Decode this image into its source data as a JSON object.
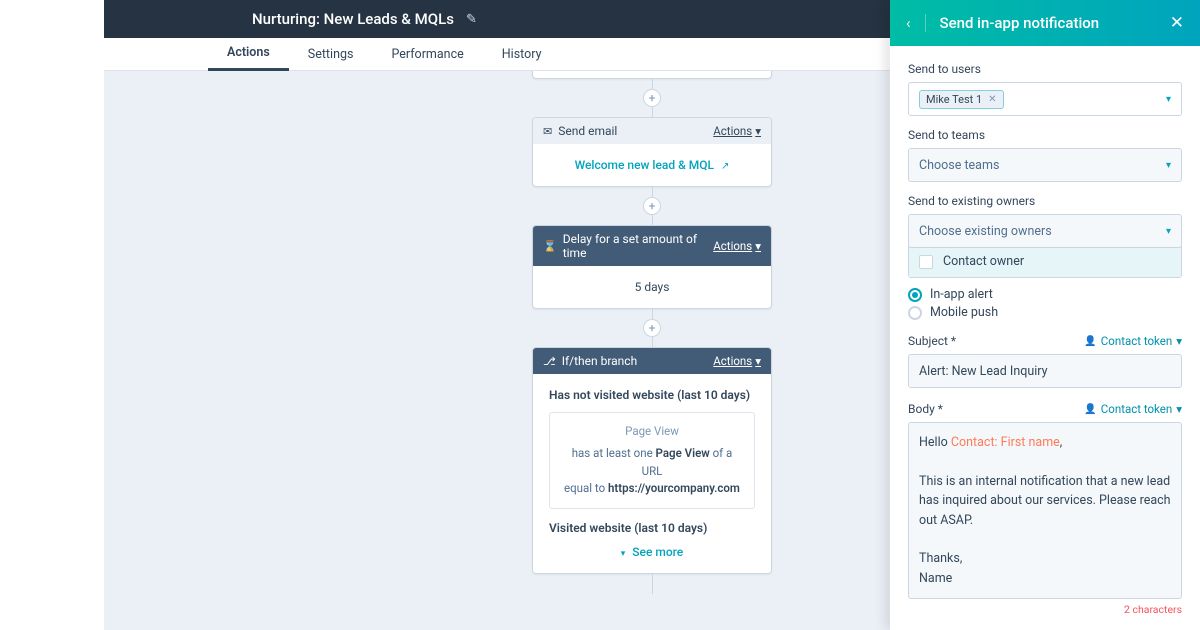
{
  "header": {
    "title": "Nurturing: New Leads & MQLs"
  },
  "tabs": {
    "items": [
      "Actions",
      "Settings",
      "Performance",
      "History"
    ],
    "active": 0
  },
  "flow": {
    "email_card": {
      "head": "Send email",
      "actions": "Actions",
      "link": "Welcome new lead & MQL"
    },
    "delay_card": {
      "head": "Delay for a set amount of time",
      "actions": "Actions",
      "body": "5 days"
    },
    "branch_card": {
      "head": "If/then branch",
      "actions": "Actions",
      "branch1_title": "Has not visited website (last 10 days)",
      "filter_title": "Page View",
      "filter_line1a": "has at least one ",
      "filter_line1b": "Page View",
      "filter_line1c": " of a URL",
      "filter_line2a": "equal to ",
      "filter_line2b": "https://yourcompany.com",
      "branch2_title": "Visited website (last 10 days)",
      "see_more": "See more"
    }
  },
  "panel": {
    "title": "Send in-app notification",
    "users_label": "Send to users",
    "users_chip": "Mike Test 1",
    "teams_label": "Send to teams",
    "teams_placeholder": "Choose teams",
    "owners_label": "Send to existing owners",
    "owners_placeholder": "Choose existing owners",
    "owners_option": "Contact owner",
    "radio_inapp": "In-app alert",
    "radio_mobile": "Mobile push",
    "subject_label": "Subject *",
    "contact_token": "Contact token",
    "subject_value": "Alert: New Lead Inquiry",
    "body_label": "Body *",
    "body_hello": "Hello ",
    "body_token": "Contact: First name",
    "body_comma": ",",
    "body_para": "This is an internal notification that a new lead has inquired about our services. Please reach out ASAP.",
    "body_thanks": "Thanks,",
    "body_name": "Name",
    "char_count": "2 characters"
  }
}
